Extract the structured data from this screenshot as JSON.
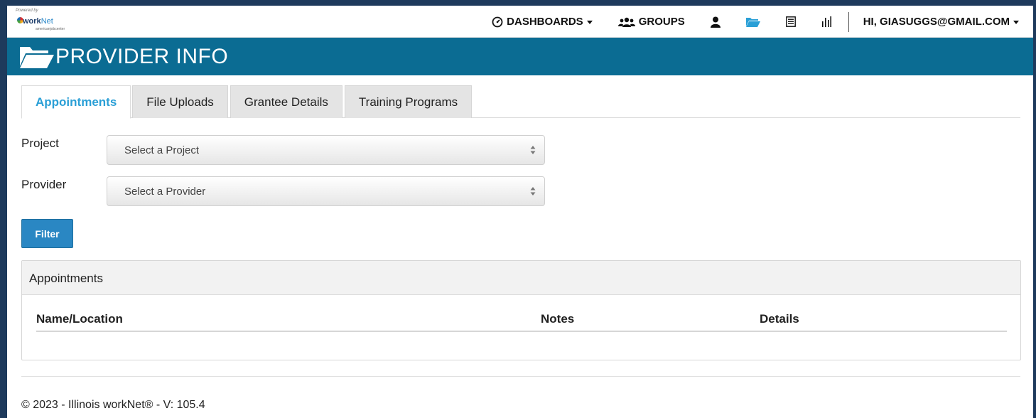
{
  "logo": {
    "powered": "Powered by",
    "illinois": "Illinois",
    "brand": "work",
    "brand_suffix": "Net",
    "partner": "americanjobcenter"
  },
  "nav": {
    "dashboards": "DASHBOARDS",
    "groups": "GROUPS",
    "user": "HI, GIASUGGS@GMAIL.COM"
  },
  "page": {
    "title": "PROVIDER INFO"
  },
  "tabs": [
    {
      "label": "Appointments",
      "active": true
    },
    {
      "label": "File Uploads",
      "active": false
    },
    {
      "label": "Grantee Details",
      "active": false
    },
    {
      "label": "Training Programs",
      "active": false
    }
  ],
  "form": {
    "project_label": "Project",
    "project_value": "Select a Project",
    "provider_label": "Provider",
    "provider_value": "Select a Provider",
    "filter_button": "Filter"
  },
  "appointments": {
    "heading": "Appointments",
    "columns": [
      "Name/Location",
      "Notes",
      "Details"
    ]
  },
  "footer": {
    "text": "© 2023 - Illinois workNet® - V: 105.4"
  },
  "colors": {
    "header_blue": "#0b6c93",
    "active_tab": "#2a9fd6",
    "button_blue": "#2a87c3"
  }
}
